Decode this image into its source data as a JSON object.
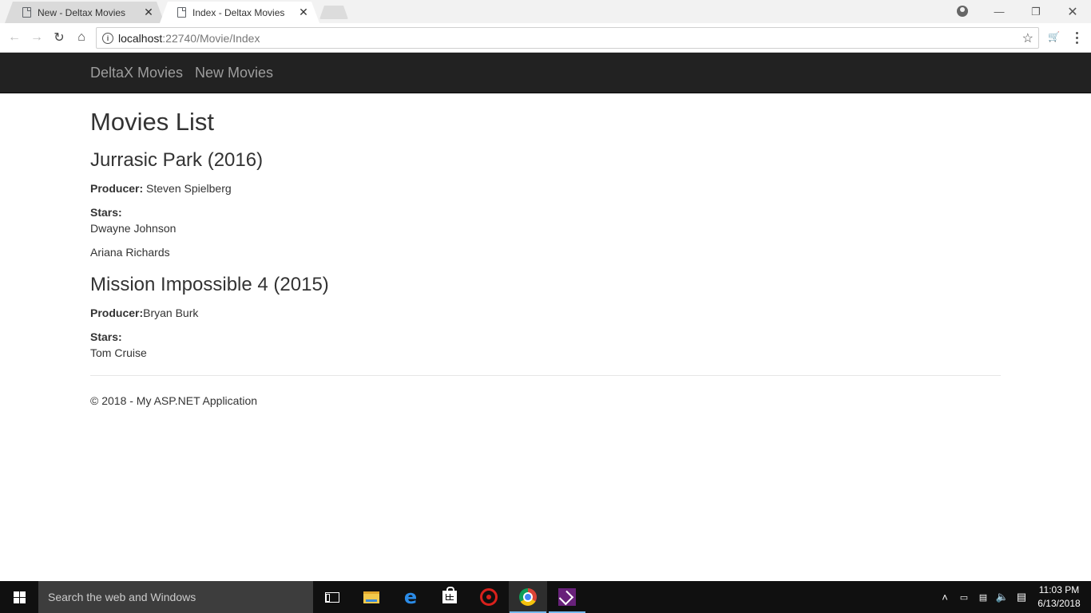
{
  "browser": {
    "tabs": [
      {
        "title": "New - Deltax Movies",
        "active": false
      },
      {
        "title": "Index - Deltax Movies",
        "active": true
      }
    ],
    "url_host": "localhost",
    "url_rest": ":22740/Movie/Index"
  },
  "site": {
    "brand": "DeltaX Movies",
    "nav_link": "New Movies"
  },
  "main": {
    "heading": "Movies List",
    "movies": [
      {
        "title": "Jurrasic Park (2016)",
        "producer_label": "Producer:",
        "producer": " Steven Spielberg",
        "stars_label": "Stars:",
        "stars": [
          "Dwayne Johnson",
          "Ariana Richards"
        ]
      },
      {
        "title": "Mission Impossible 4 (2015)",
        "producer_label": "Producer:",
        "producer": "Bryan Burk",
        "stars_label": "Stars:",
        "stars": [
          "Tom Cruise"
        ]
      }
    ],
    "footer": "© 2018 - My ASP.NET Application"
  },
  "taskbar": {
    "search_placeholder": "Search the web and Windows",
    "time": "11:03 PM",
    "date": "6/13/2018"
  },
  "icons": {
    "edge_glyph": "e",
    "close_glyph": "✕",
    "star_glyph": "☆"
  }
}
